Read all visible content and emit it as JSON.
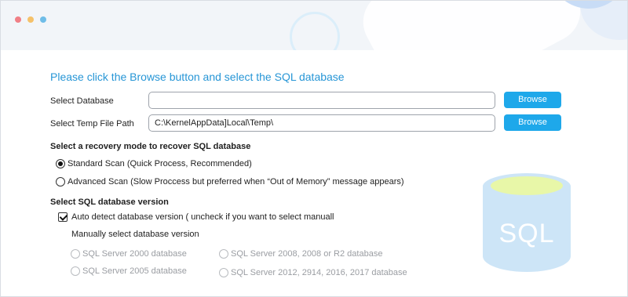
{
  "window": {
    "controls": [
      "close",
      "minimize",
      "maximize"
    ]
  },
  "instruction": "Please click the Browse button and select the SQL database",
  "database_row": {
    "label": "Select Database",
    "value": "",
    "browse_label": "Browse"
  },
  "temp_path_row": {
    "label": "Select Temp File Path",
    "value": "C:\\KernelAppData]Local\\Temp\\",
    "browse_label": "Browse"
  },
  "recovery": {
    "heading": "Select a recovery mode to recover SQL database",
    "options": [
      {
        "label": "Standard Scan (Quick Process, Recommended)",
        "selected": true
      },
      {
        "label": "Advanced Scan (Slow Proccess but preferred when “Out of Memory” message appears)",
        "selected": false
      }
    ]
  },
  "version": {
    "heading": "Select SQL database version",
    "auto_detect": {
      "label": "Auto detect database version ( uncheck if you want to select manuall",
      "checked": true
    },
    "manual_label": "Manually select database version",
    "options": [
      {
        "label": "SQL Server 2000 database",
        "enabled": false
      },
      {
        "label": "SQL Server 2005 database",
        "enabled": false
      },
      {
        "label": "SQL Server 2008, 2008 or R2 database",
        "enabled": false
      },
      {
        "label": "SQL Server 2012, 2914, 2016, 2017 database",
        "enabled": false
      }
    ]
  },
  "illustration": {
    "text": "SQL",
    "icon": "database-icon"
  },
  "colors": {
    "accent": "#1ea8ea",
    "heading_blue": "#2796d6",
    "db_body": "#cde5f7",
    "db_top": "#e8f7a8"
  }
}
